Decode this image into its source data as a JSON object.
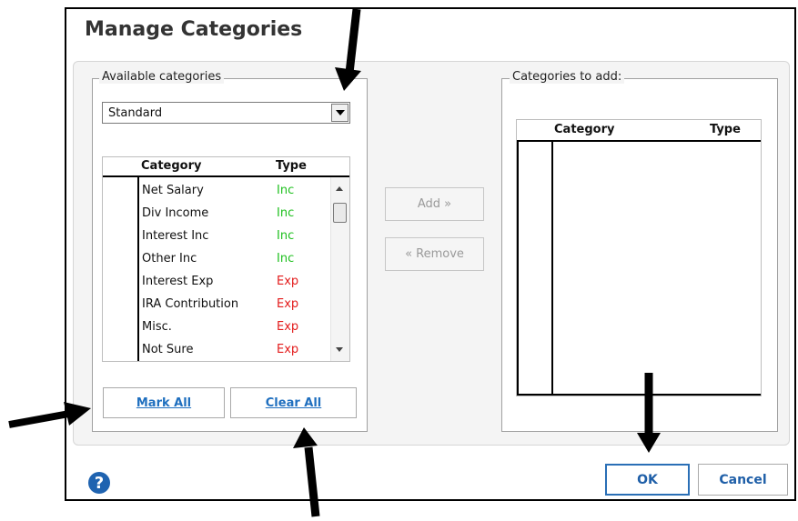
{
  "dialog": {
    "title": "Manage Categories"
  },
  "available": {
    "group_label": "Available categories",
    "dropdown_value": "Standard",
    "columns": [
      "Category",
      "Type"
    ],
    "rows": [
      {
        "category": "Net Salary",
        "type": "Inc"
      },
      {
        "category": "Div Income",
        "type": "Inc"
      },
      {
        "category": "Interest Inc",
        "type": "Inc"
      },
      {
        "category": "Other Inc",
        "type": "Inc"
      },
      {
        "category": "Interest Exp",
        "type": "Exp"
      },
      {
        "category": "IRA Contribution",
        "type": "Exp"
      },
      {
        "category": "Misc.",
        "type": "Exp"
      },
      {
        "category": "Not Sure",
        "type": "Exp"
      }
    ],
    "mark_all_label": "Mark All",
    "clear_all_label": "Clear All"
  },
  "actions": {
    "add_label": "Add »",
    "remove_label": "« Remove"
  },
  "to_add": {
    "group_label": "Categories to add:",
    "columns": [
      "Category",
      "Type"
    ]
  },
  "footer": {
    "help_symbol": "?",
    "ok_label": "OK",
    "cancel_label": "Cancel"
  },
  "colors": {
    "inc": "#1fc01f",
    "exp": "#e31b1b",
    "accent": "#1f6fbf"
  }
}
